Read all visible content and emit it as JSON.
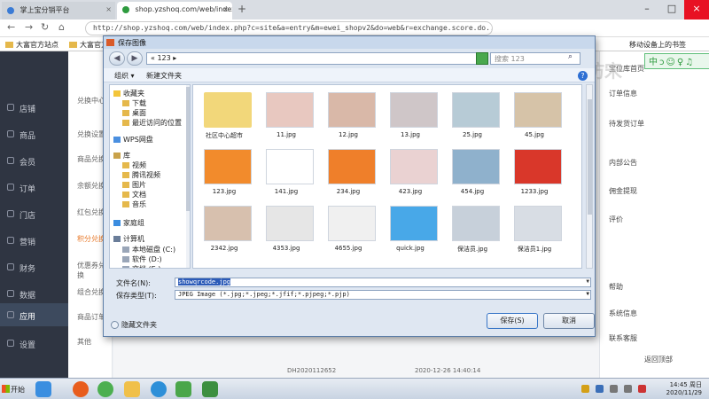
{
  "browser": {
    "tabs": [
      {
        "label": "掌上宝分销平台"
      },
      {
        "label": "shop.yzshoq.com/web/index.php"
      }
    ],
    "new_tab": "+",
    "url": "http://shop.yzshoq.com/web/index.php?c=site&a=entry&m=ewei_shopv2&do=web&r=exchange.score.do...",
    "bookmarks": [
      "大富官方站点",
      "大富官方站点"
    ],
    "bookmark_right": "移动设备上的书签"
  },
  "app": {
    "sidebar": [
      "店铺",
      "商品",
      "会员",
      "订单",
      "门店",
      "营销",
      "财务",
      "数据",
      "应用",
      "设置"
    ],
    "active_index": 8,
    "subnav": [
      "兑换中心",
      "兑换设置",
      "商品兑换",
      "余额兑换",
      "红包兑换",
      "积分兑换",
      "优惠券兑换",
      "组合兑换",
      "商品订单",
      "其他"
    ],
    "subnav_highlight_index": 5,
    "right_panel": [
      "订单信息",
      "待发货订单",
      "内部公告",
      "佣金提现",
      "评价",
      "帮助",
      "系统信息",
      "联系客服",
      "返回顶部"
    ],
    "right_title": "宝位库首页",
    "tools": "中ↄ☺♀♫",
    "table_row": {
      "id": "DH2020112652",
      "time": "2020-12-26 14:40:14"
    },
    "watermark": "仿宋"
  },
  "dialog": {
    "title": "保存图像",
    "path": "« 123 ▸",
    "search_placeholder": "搜索 123",
    "organize": "组织 ▾",
    "new_folder": "新建文件夹",
    "help": "?",
    "tree": [
      {
        "label": "收藏夹",
        "kind": "star"
      },
      {
        "label": "下载",
        "kind": "folder"
      },
      {
        "label": "桌面",
        "kind": "folder"
      },
      {
        "label": "最近访问的位置",
        "kind": "folder"
      },
      {
        "label": "WPS网盘",
        "kind": "cloud"
      },
      {
        "label": "库",
        "kind": "lib"
      },
      {
        "label": "视频",
        "kind": "folder"
      },
      {
        "label": "腾讯视频",
        "kind": "folder"
      },
      {
        "label": "图片",
        "kind": "folder"
      },
      {
        "label": "文档",
        "kind": "folder"
      },
      {
        "label": "音乐",
        "kind": "folder"
      },
      {
        "label": "家庭组",
        "kind": "home"
      },
      {
        "label": "计算机",
        "kind": "pc"
      },
      {
        "label": "本地磁盘 (C:)",
        "kind": "drive"
      },
      {
        "label": "软件 (D:)",
        "kind": "drive"
      },
      {
        "label": "文档 (E:)",
        "kind": "drive"
      }
    ],
    "files": [
      {
        "name": "社区中心超市",
        "color": "#f2d77a",
        "kind": "folder"
      },
      {
        "name": "11.jpg",
        "color": "#e8c8c0"
      },
      {
        "name": "12.jpg",
        "color": "#d9b8a8"
      },
      {
        "name": "13.jpg",
        "color": "#cfc6c8"
      },
      {
        "name": "25.jpg",
        "color": "#b7cbd6"
      },
      {
        "name": "45.jpg",
        "color": "#d6c3a8"
      },
      {
        "name": "123.jpg",
        "color": "#f28b2c"
      },
      {
        "name": "141.jpg",
        "color": "#ffffff"
      },
      {
        "name": "234.jpg",
        "color": "#ef7f2a"
      },
      {
        "name": "423.jpg",
        "color": "#ead2d2"
      },
      {
        "name": "454.jpg",
        "color": "#8fb1cc"
      },
      {
        "name": "1233.jpg",
        "color": "#d9372a"
      },
      {
        "name": "2342.jpg",
        "color": "#d7c0ae"
      },
      {
        "name": "4353.jpg",
        "color": "#e6e6e6"
      },
      {
        "name": "4655.jpg",
        "color": "#f0f0f0"
      },
      {
        "name": "quick.jpg",
        "color": "#48a8e8"
      },
      {
        "name": "保洁员.jpg",
        "color": "#c7d0da"
      },
      {
        "name": "保洁员1.jpg",
        "color": "#d8dde4"
      }
    ],
    "filename_label": "文件名(N):",
    "filename_value": "showqrcode.jpg",
    "filetype_label": "保存类型(T):",
    "filetype_value": "JPEG Image (*.jpg;*.jpeg;*.jfif;*.pjpeg;*.pjp)",
    "hide_folders": "隐藏文件夹",
    "save": "保存(S)",
    "cancel": "取消"
  },
  "taskbar": {
    "start": "开始",
    "time": "14:45",
    "weekday": "周日",
    "date": "2020/11/29"
  },
  "colors": {
    "sidebar_bg": "#2f3542",
    "accent": "#2e9b3f",
    "dialog_bg": "#dfe7f2"
  }
}
